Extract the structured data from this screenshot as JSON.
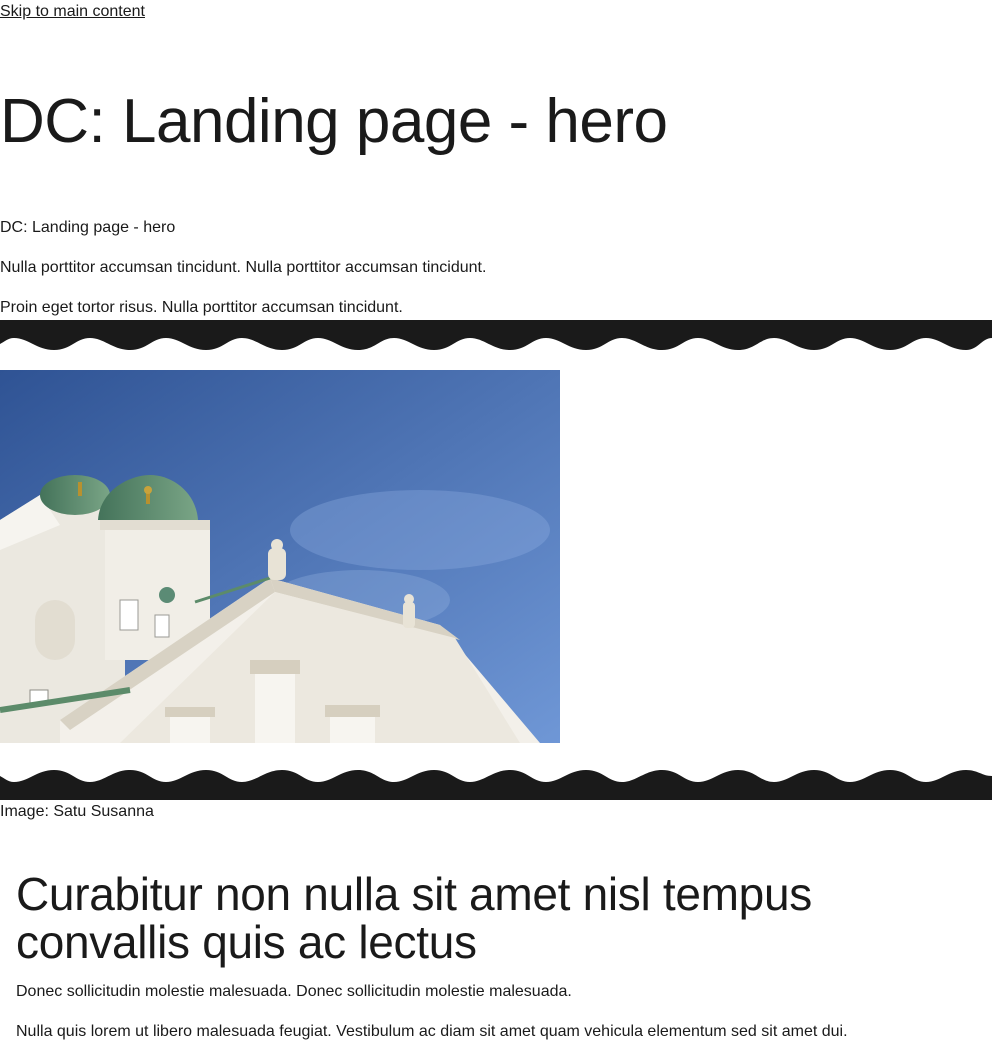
{
  "skip_link": {
    "label": "Skip to main content"
  },
  "page": {
    "title": "DC: Landing page - hero"
  },
  "hero": {
    "paragraphs": [
      "DC: Landing page - hero",
      "Nulla porttitor accumsan tincidunt. Nulla porttitor accumsan tincidunt.",
      "Proin eget tortor risus. Nulla porttitor accumsan tincidunt."
    ],
    "image": {
      "caption": "Image: Satu Susanna"
    }
  },
  "main": {
    "heading": "Curabitur non nulla sit amet nisl tempus convallis quis ac lectus",
    "paragraphs": [
      "Donec sollicitudin molestie malesuada. Donec sollicitudin molestie malesuada.",
      "Nulla quis lorem ut libero malesuada feugiat. Vestibulum ac diam sit amet quam vehicula elementum sed sit amet dui."
    ]
  },
  "colors": {
    "text": "#1a1a1a",
    "koros": "#1a1a1a",
    "sky_top": "#2f5394",
    "sky_bottom": "#6f97d6",
    "building": "#f0ede6",
    "dome": "#5c8b6a"
  }
}
